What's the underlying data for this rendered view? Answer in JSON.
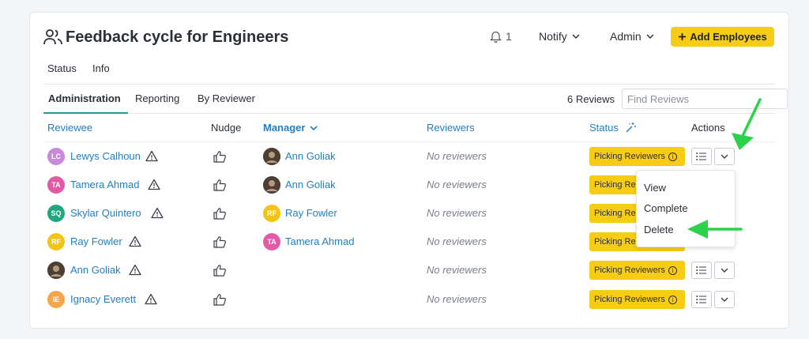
{
  "header": {
    "title": "Feedback cycle for Engineers",
    "notifications_count": "1",
    "notify_label": "Notify",
    "admin_label": "Admin",
    "add_button_label": "Add Employees"
  },
  "subnav": {
    "status": "Status",
    "info": "Info"
  },
  "tabs": [
    {
      "label": "Administration",
      "active": true
    },
    {
      "label": "Reporting",
      "active": false
    },
    {
      "label": "By Reviewer",
      "active": false
    }
  ],
  "reviews_count": "6 Reviews",
  "search": {
    "placeholder": "Find Reviews"
  },
  "columns": {
    "reviewee": "Reviewee",
    "nudge": "Nudge",
    "manager": "Manager",
    "reviewers": "Reviewers",
    "status": "Status",
    "actions": "Actions"
  },
  "rows": [
    {
      "reviewee": "Lewys Calhoun",
      "reviewee_initials": "LC",
      "reviewee_color": "#c88ad8",
      "manager": "Ann Goliak",
      "manager_initials": "",
      "manager_color": "",
      "reviewers": "No reviewers",
      "status": "Picking Reviewers"
    },
    {
      "reviewee": "Tamera Ahmad",
      "reviewee_initials": "TA",
      "reviewee_color": "#e25aa6",
      "manager": "Ann Goliak",
      "manager_initials": "",
      "manager_color": "",
      "reviewers": "No reviewers",
      "status": "Picking Re"
    },
    {
      "reviewee": "Skylar Quintero",
      "reviewee_initials": "SQ",
      "reviewee_color": "#20a77e",
      "manager": "Ray Fowler",
      "manager_initials": "RF",
      "manager_color": "#f2c418",
      "reviewers": "No reviewers",
      "status": "Picking Re"
    },
    {
      "reviewee": "Ray Fowler",
      "reviewee_initials": "RF",
      "reviewee_color": "#f2c418",
      "manager": "Tamera Ahmad",
      "manager_initials": "TA",
      "manager_color": "#e25aa6",
      "reviewers": "No reviewers",
      "status": "Picking Re"
    },
    {
      "reviewee": "Ann Goliak",
      "reviewee_initials": "",
      "reviewee_color": "",
      "manager": "",
      "manager_initials": "",
      "manager_color": "",
      "reviewers": "No reviewers",
      "status": "Picking Reviewers"
    },
    {
      "reviewee": "Ignacy Everett",
      "reviewee_initials": "IE",
      "reviewee_color": "#f5a64a",
      "manager": "",
      "manager_initials": "",
      "manager_color": "",
      "reviewers": "No reviewers",
      "status": "Picking Reviewers"
    }
  ],
  "dropdown": {
    "items": [
      "View",
      "Complete",
      "Delete"
    ]
  },
  "colors": {
    "accent_link": "#1f7fc4",
    "brand_yellow": "#f7cc15",
    "tab_underline": "#1a9e8f",
    "arrow_green": "#2bd24a"
  },
  "icons": [
    "people-icon",
    "bell-icon",
    "chevron-down-icon",
    "plus-icon",
    "sparkle-icon",
    "warning-icon",
    "thumbs-up-icon",
    "info-icon",
    "list-icon"
  ]
}
